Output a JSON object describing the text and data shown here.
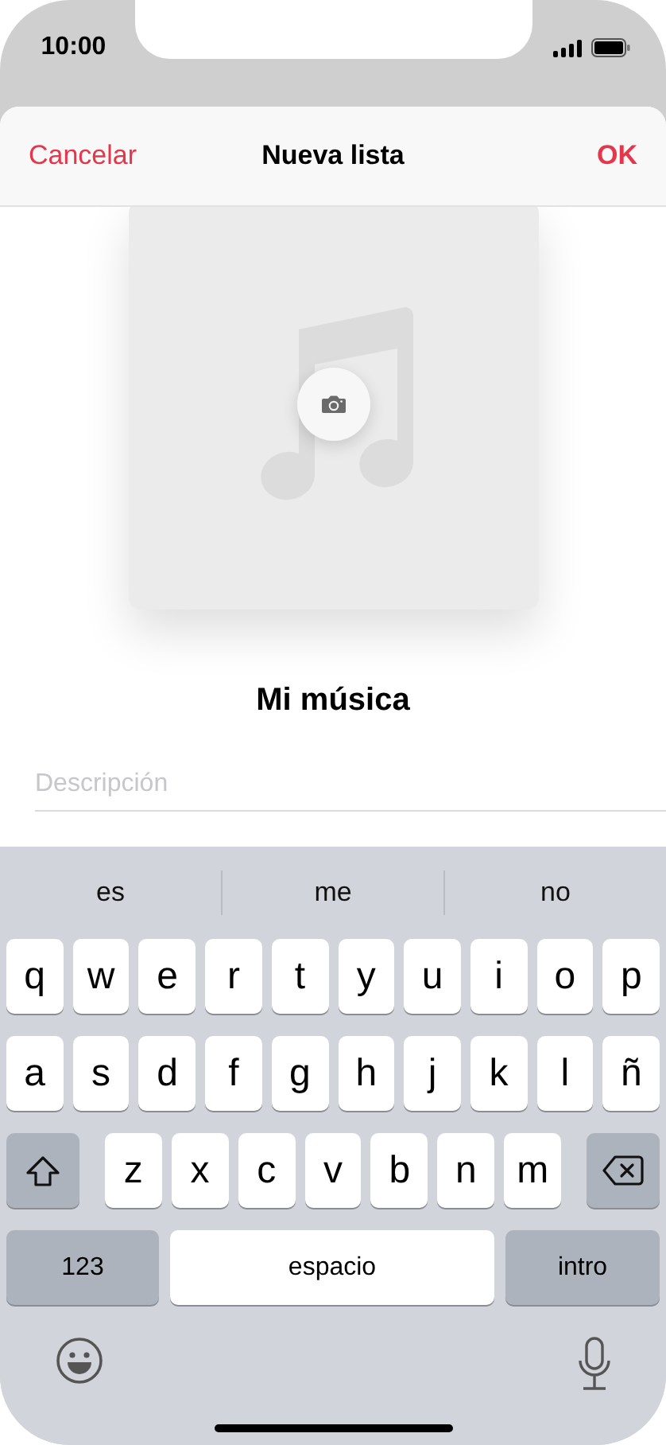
{
  "status_bar": {
    "time": "10:00"
  },
  "nav": {
    "cancel": "Cancelar",
    "title": "Nueva lista",
    "ok": "OK"
  },
  "playlist_name": "Mi música",
  "description": {
    "placeholder": "Descripción"
  },
  "keyboard": {
    "suggestions": [
      "es",
      "me",
      "no"
    ],
    "rows": [
      {
        "keys": [
          {
            "kind": "letter",
            "label": "q"
          },
          {
            "kind": "letter",
            "label": "w"
          },
          {
            "kind": "letter",
            "label": "e"
          },
          {
            "kind": "letter",
            "label": "r"
          },
          {
            "kind": "letter",
            "label": "t"
          },
          {
            "kind": "letter",
            "label": "y"
          },
          {
            "kind": "letter",
            "label": "u"
          },
          {
            "kind": "letter",
            "label": "i"
          },
          {
            "kind": "letter",
            "label": "o"
          },
          {
            "kind": "letter",
            "label": "p"
          }
        ]
      },
      {
        "keys": [
          {
            "kind": "letter",
            "label": "a"
          },
          {
            "kind": "letter",
            "label": "s"
          },
          {
            "kind": "letter",
            "label": "d"
          },
          {
            "kind": "letter",
            "label": "f"
          },
          {
            "kind": "letter",
            "label": "g"
          },
          {
            "kind": "letter",
            "label": "h"
          },
          {
            "kind": "letter",
            "label": "j"
          },
          {
            "kind": "letter",
            "label": "k"
          },
          {
            "kind": "letter",
            "label": "l"
          },
          {
            "kind": "letter",
            "label": "ñ"
          }
        ]
      },
      {
        "keys": [
          {
            "kind": "shift"
          },
          {
            "kind": "letter",
            "label": "z"
          },
          {
            "kind": "letter",
            "label": "x"
          },
          {
            "kind": "letter",
            "label": "c"
          },
          {
            "kind": "letter",
            "label": "v"
          },
          {
            "kind": "letter",
            "label": "b"
          },
          {
            "kind": "letter",
            "label": "n"
          },
          {
            "kind": "letter",
            "label": "m"
          },
          {
            "kind": "backspace"
          }
        ]
      },
      {
        "keys": [
          {
            "kind": "mode",
            "label": "123"
          },
          {
            "kind": "space",
            "label": "espacio"
          },
          {
            "kind": "return",
            "label": "intro"
          }
        ]
      }
    ]
  }
}
